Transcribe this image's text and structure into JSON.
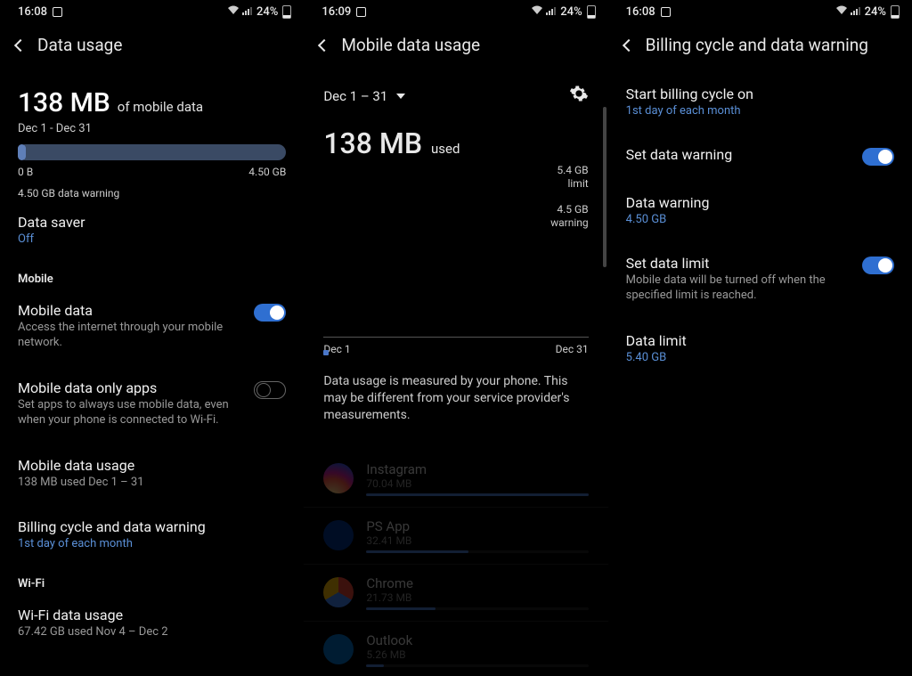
{
  "status": {
    "time1": "16:08",
    "time2": "16:09",
    "time3": "16:08",
    "battery": "24%"
  },
  "p1": {
    "title": "Data usage",
    "usage_amount": "138 MB",
    "usage_suffix": "of mobile data",
    "date_range": "Dec 1 - Dec 31",
    "progress_min": "0 B",
    "progress_max": "4.50 GB",
    "warning": "4.50 GB data warning",
    "saver": {
      "title": "Data saver",
      "value": "Off"
    },
    "section_mobile": "Mobile",
    "mobile_data": {
      "title": "Mobile data",
      "desc": "Access the internet through your mobile network."
    },
    "mobile_only": {
      "title": "Mobile data only apps",
      "desc": "Set apps to always use mobile data, even when your phone is connected to Wi-Fi."
    },
    "mobile_usage": {
      "title": "Mobile data usage",
      "desc": "138 MB used Dec 1 – 31"
    },
    "billing": {
      "title": "Billing cycle and data warning",
      "value": "1st day of each month"
    },
    "section_wifi": "Wi-Fi",
    "wifi_usage": {
      "title": "Wi-Fi data usage",
      "desc": "67.42 GB used Nov 4 – Dec 2"
    }
  },
  "p2": {
    "title": "Mobile data usage",
    "period": "Dec 1 – 31",
    "usage_amount": "138 MB",
    "used_label": "used",
    "limit_val": "5.4 GB",
    "limit_lbl": "limit",
    "warn_val": "4.5 GB",
    "warn_lbl": "warning",
    "chart_start": "Dec 1",
    "chart_end": "Dec 31",
    "note": "Data usage is measured by your phone. This may be different from your service provider's measurements.",
    "apps": [
      {
        "name": "Instagram",
        "size": "70.04 MB",
        "pct": 100
      },
      {
        "name": "PS App",
        "size": "32.41 MB",
        "pct": 46
      },
      {
        "name": "Chrome",
        "size": "21.73 MB",
        "pct": 31
      },
      {
        "name": "Outlook",
        "size": "5.26 MB",
        "pct": 8
      }
    ]
  },
  "p3": {
    "title": "Billing cycle and data warning",
    "start_cycle": {
      "title": "Start billing cycle on",
      "value": "1st day of each month"
    },
    "set_warning": {
      "title": "Set data warning"
    },
    "data_warning": {
      "title": "Data warning",
      "value": "4.50 GB"
    },
    "set_limit": {
      "title": "Set data limit",
      "desc": "Mobile data will be turned off when the specified limit is reached."
    },
    "data_limit": {
      "title": "Data limit",
      "value": "5.40 GB"
    }
  },
  "chart_data": {
    "type": "bar",
    "title": "Mobile data usage",
    "x_start": "Dec 1",
    "x_end": "Dec 31",
    "limit_gb": 5.4,
    "warning_gb": 4.5,
    "total_mb": 138,
    "apps": [
      {
        "name": "Instagram",
        "mb": 70.04
      },
      {
        "name": "PS App",
        "mb": 32.41
      },
      {
        "name": "Chrome",
        "mb": 21.73
      },
      {
        "name": "Outlook",
        "mb": 5.26
      }
    ]
  }
}
